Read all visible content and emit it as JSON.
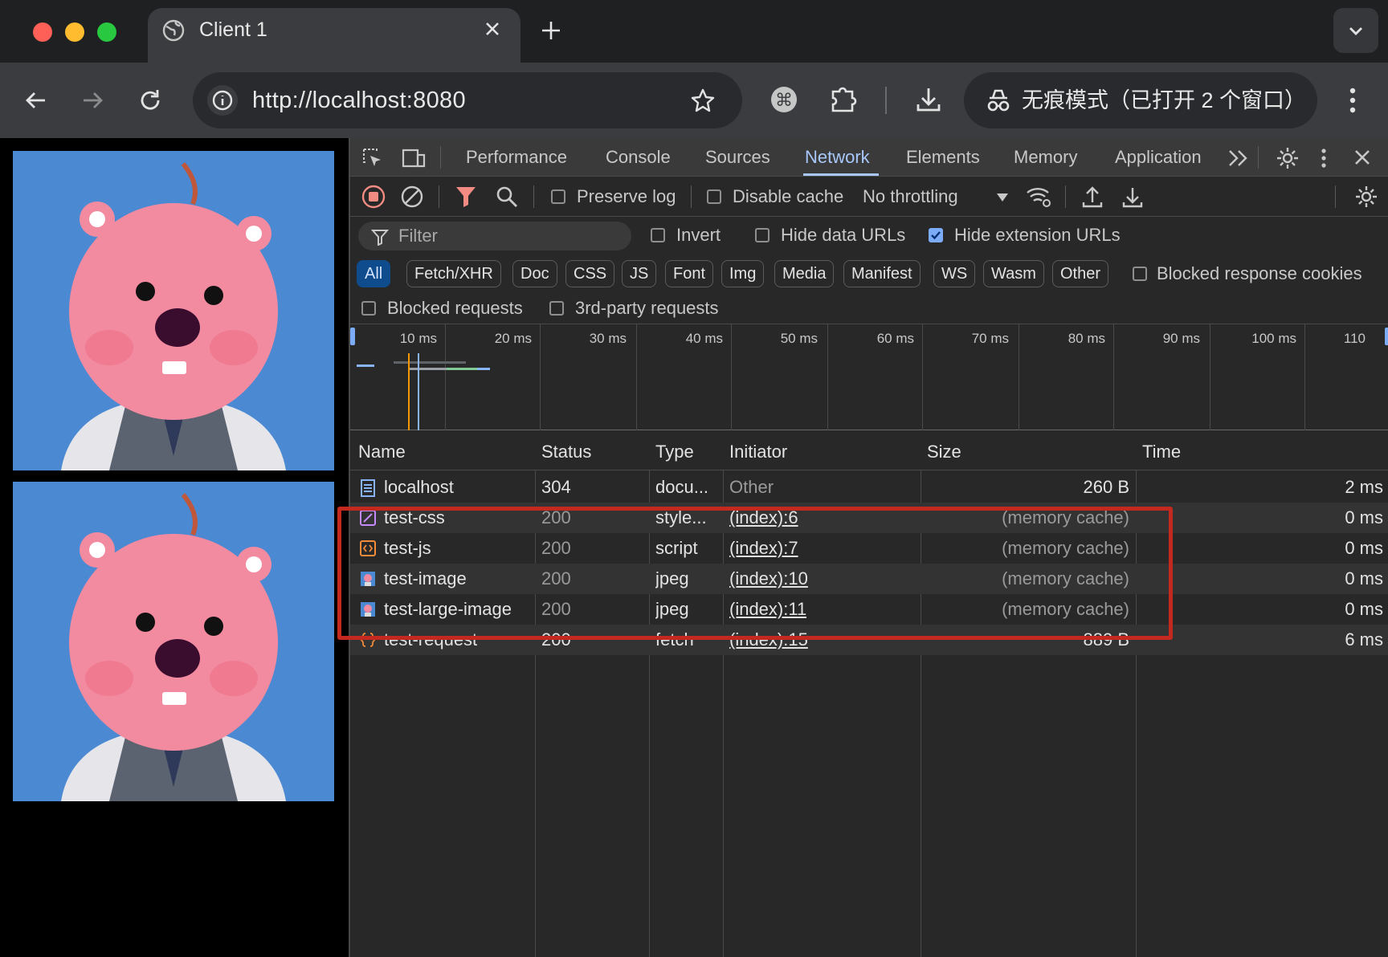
{
  "browser": {
    "tab_title": "Client 1",
    "url": "http://localhost:8080",
    "incognito_label": "无痕模式（已打开 2 个窗口）"
  },
  "devtools": {
    "tabs": [
      "Performance",
      "Console",
      "Sources",
      "Network",
      "Elements",
      "Memory",
      "Application"
    ],
    "active_tab": "Network",
    "controls": {
      "preserve_log": "Preserve log",
      "disable_cache": "Disable cache",
      "throttling": "No throttling"
    },
    "filter": {
      "placeholder": "Filter",
      "invert": "Invert",
      "hide_data_urls": "Hide data URLs",
      "hide_extension_urls": "Hide extension URLs",
      "hide_extension_urls_checked": true
    },
    "type_filters": [
      "All",
      "Fetch/XHR",
      "Doc",
      "CSS",
      "JS",
      "Font",
      "Img",
      "Media",
      "Manifest",
      "WS",
      "Wasm",
      "Other"
    ],
    "blocked_response_cookies": "Blocked response cookies",
    "blocked_requests": "Blocked requests",
    "third_party_requests": "3rd-party requests",
    "timeline_ticks": [
      "10 ms",
      "20 ms",
      "30 ms",
      "40 ms",
      "50 ms",
      "60 ms",
      "70 ms",
      "80 ms",
      "90 ms",
      "100 ms",
      "110"
    ],
    "columns": [
      "Name",
      "Status",
      "Type",
      "Initiator",
      "Size",
      "Time"
    ],
    "requests": [
      {
        "name": "localhost",
        "status": "304",
        "type": "docu...",
        "initiator": "Other",
        "size": "260 B",
        "time": "2 ms",
        "icon": "document-icon"
      },
      {
        "name": "test-css",
        "status": "200",
        "type": "style...",
        "initiator": "(index):6",
        "size": "(memory cache)",
        "time": "0 ms",
        "icon": "stylesheet-icon"
      },
      {
        "name": "test-js",
        "status": "200",
        "type": "script",
        "initiator": "(index):7",
        "size": "(memory cache)",
        "time": "0 ms",
        "icon": "script-icon"
      },
      {
        "name": "test-image",
        "status": "200",
        "type": "jpeg",
        "initiator": "(index):10",
        "size": "(memory cache)",
        "time": "0 ms",
        "icon": "image-icon"
      },
      {
        "name": "test-large-image",
        "status": "200",
        "type": "jpeg",
        "initiator": "(index):11",
        "size": "(memory cache)",
        "time": "0 ms",
        "icon": "image-icon"
      },
      {
        "name": "test-request",
        "status": "200",
        "type": "fetch",
        "initiator": "(index):15",
        "size": "889 B",
        "time": "6 ms",
        "icon": "fetch-icon"
      }
    ]
  },
  "colors": {
    "highlight_box": "#c4291f",
    "active_tab": "#a8c7fa",
    "page_image_bg": "#4b8ad3"
  }
}
